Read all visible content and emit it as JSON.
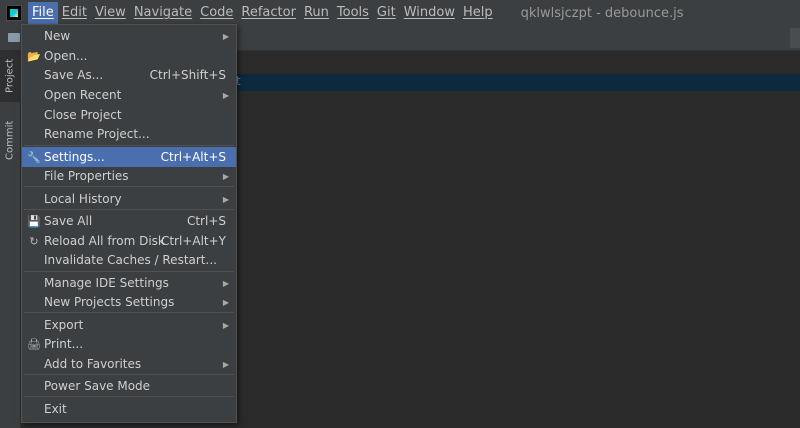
{
  "menubar": {
    "items": [
      "File",
      "Edit",
      "View",
      "Navigate",
      "Code",
      "Refactor",
      "Run",
      "Tools",
      "Git",
      "Window",
      "Help"
    ],
    "window_title": "qklwlsjczpt - debounce.js"
  },
  "sidebar": {
    "tabs": [
      "Project",
      "Commit"
    ]
  },
  "file_menu": {
    "items": [
      {
        "label": "New",
        "shortcut": "",
        "submenu": true,
        "icon": ""
      },
      {
        "label": "Open...",
        "shortcut": "",
        "submenu": false,
        "icon": "folder-open-icon"
      },
      {
        "label": "Save As...",
        "shortcut": "Ctrl+Shift+S",
        "submenu": false,
        "icon": ""
      },
      {
        "label": "Open Recent",
        "shortcut": "",
        "submenu": true,
        "icon": ""
      },
      {
        "label": "Close Project",
        "shortcut": "",
        "submenu": false,
        "icon": ""
      },
      {
        "label": "Rename Project...",
        "shortcut": "",
        "submenu": false,
        "icon": ""
      },
      {
        "label": "Settings...",
        "shortcut": "Ctrl+Alt+S",
        "submenu": false,
        "icon": "wrench-icon",
        "highlighted": true
      },
      {
        "label": "File Properties",
        "shortcut": "",
        "submenu": true,
        "icon": ""
      },
      {
        "label": "Local History",
        "shortcut": "",
        "submenu": true,
        "icon": ""
      },
      {
        "label": "Save All",
        "shortcut": "Ctrl+S",
        "submenu": false,
        "icon": "save-icon"
      },
      {
        "label": "Reload All from Disk",
        "shortcut": "Ctrl+Alt+Y",
        "submenu": false,
        "icon": "reload-icon"
      },
      {
        "label": "Invalidate Caches / Restart...",
        "shortcut": "",
        "submenu": false,
        "icon": ""
      },
      {
        "label": "Manage IDE Settings",
        "shortcut": "",
        "submenu": true,
        "icon": ""
      },
      {
        "label": "New Projects Settings",
        "shortcut": "",
        "submenu": true,
        "icon": ""
      },
      {
        "label": "Export",
        "shortcut": "",
        "submenu": true,
        "icon": ""
      },
      {
        "label": "Print...",
        "shortcut": "",
        "submenu": false,
        "icon": "print-icon"
      },
      {
        "label": "Add to Favorites",
        "shortcut": "",
        "submenu": true,
        "icon": ""
      },
      {
        "label": "Power Save Mode",
        "shortcut": "",
        "submenu": false,
        "icon": ""
      },
      {
        "label": "Exit",
        "shortcut": "",
        "submenu": false,
        "icon": ""
      }
    ]
  },
  "colors": {
    "menubar_bg": "#3c3f41",
    "editor_bg": "#2b2b2b",
    "highlight": "#4b6eaf",
    "selected_line": "#0d293e"
  }
}
